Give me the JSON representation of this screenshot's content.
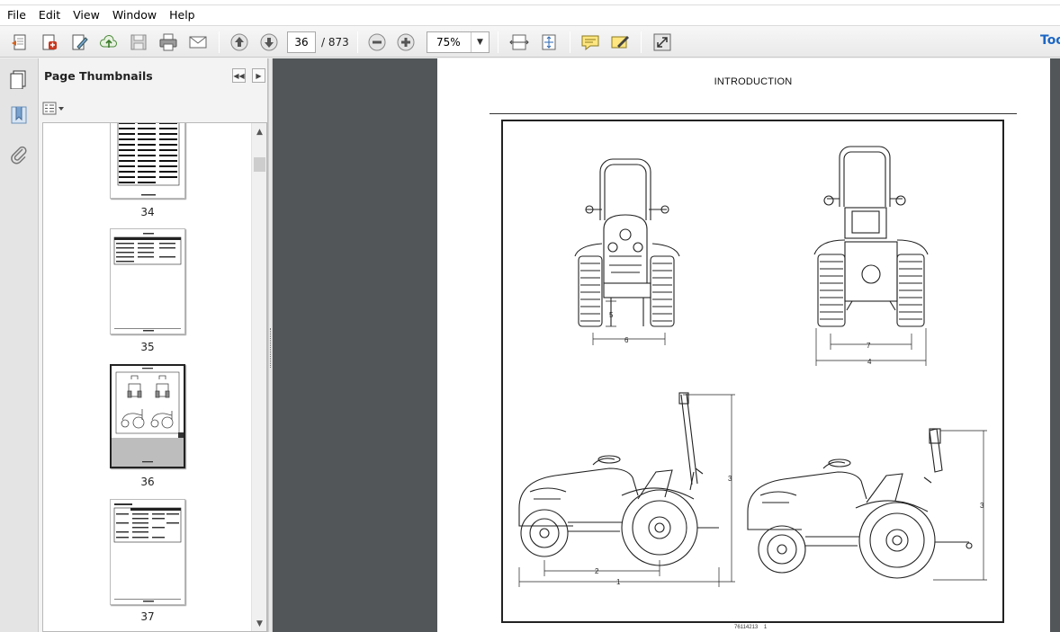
{
  "menu": {
    "items": [
      "File",
      "Edit",
      "View",
      "Window",
      "Help"
    ]
  },
  "toolbar": {
    "page_current": "36",
    "page_total": "/ 873",
    "zoom": "75%",
    "tools_label": "Tools"
  },
  "panel": {
    "title": "Page Thumbnails"
  },
  "thumbnails": [
    {
      "label": "34"
    },
    {
      "label": "35"
    },
    {
      "label": "36"
    },
    {
      "label": "37"
    }
  ],
  "document": {
    "header": "INTRODUCTION",
    "footer_code": "76114213",
    "footer_page": "1",
    "dimension_labels": [
      "5",
      "6",
      "7",
      "4",
      "3",
      "2",
      "1",
      "3"
    ]
  }
}
